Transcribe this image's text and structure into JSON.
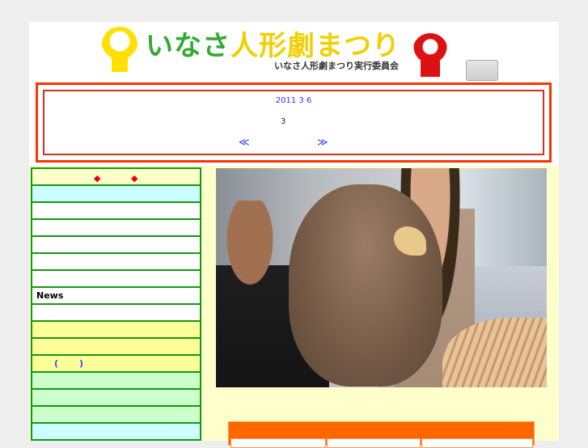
{
  "header": {
    "title_green": "いなさ",
    "title_yellow": "人",
    "title_rest": "形劇まつり",
    "subtitle": "いなさ人形劇まつり実行委員会"
  },
  "notice": {
    "date": "2011 3 6",
    "text": "3",
    "prev": "≪",
    "next": "≫"
  },
  "nav": {
    "items": [
      {
        "label": "",
        "color": "c-y",
        "diamonds": true
      },
      {
        "label": "",
        "color": "c-c"
      },
      {
        "label": "",
        "color": "c-w"
      },
      {
        "label": "",
        "color": "c-w"
      },
      {
        "label": "",
        "color": "c-w"
      },
      {
        "label": "",
        "color": "c-w"
      },
      {
        "label": "",
        "color": "c-w"
      },
      {
        "label": "News",
        "color": "c-w"
      },
      {
        "label": "",
        "color": "c-w"
      },
      {
        "label": "",
        "color": "c-yy"
      },
      {
        "label": "",
        "color": "c-yy"
      },
      {
        "label": "",
        "color": "c-yy",
        "paren_open": "(",
        "paren_close": ")"
      },
      {
        "label": "",
        "color": "c-g"
      },
      {
        "label": "",
        "color": "c-g"
      },
      {
        "label": "",
        "color": "c-g"
      },
      {
        "label": "",
        "color": "c-c"
      }
    ],
    "diamond": "◆"
  },
  "colors": {
    "accent": "#ff3300",
    "nav_border": "#119911",
    "table_header": "#ff6600"
  }
}
